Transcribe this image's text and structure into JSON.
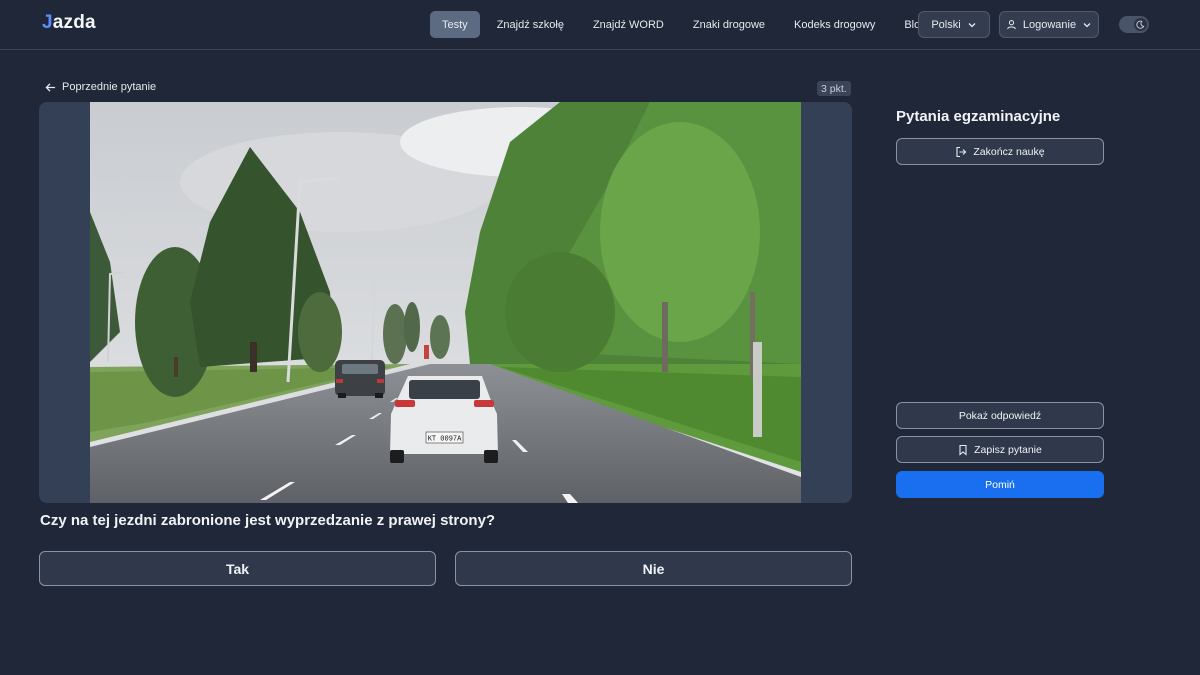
{
  "header": {
    "logo_j": "J",
    "logo_rest": "azda",
    "nav": [
      "Testy",
      "Znajdź szkołę",
      "Znajdź WORD",
      "Znaki drogowe",
      "Kodeks drogowy",
      "Blog"
    ],
    "language": "Polski",
    "login": "Logowanie"
  },
  "question": {
    "back_label": "Poprzednie pytanie",
    "points": "3 pkt.",
    "text": "Czy na tej jezdni zabronione jest wyprzedzanie z prawej strony?",
    "answers": {
      "yes": "Tak",
      "no": "Nie"
    },
    "plate": "KT 0097A"
  },
  "sidebar": {
    "title": "Pytania egzaminacyjne",
    "end_label": "Zakończ naukę",
    "show_answer_label": "Pokaż odpowiedź",
    "save_label": "Zapisz pytanie",
    "skip_label": "Pomiń"
  },
  "colors": {
    "accent": "#1a6ff0",
    "background": "#1f2738",
    "panel": "#344055"
  }
}
